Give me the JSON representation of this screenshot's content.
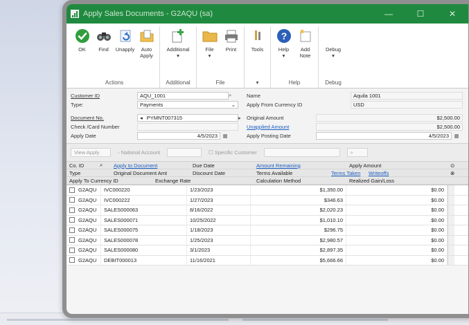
{
  "window": {
    "title": "Apply Sales Documents - G2AQU (sa)",
    "controls": [
      "—",
      "☐",
      "✕"
    ]
  },
  "ribbon": {
    "groups": [
      {
        "name": "Actions",
        "buttons": [
          {
            "label": "OK",
            "icon": "ok-check-icon"
          },
          {
            "label": "Find",
            "icon": "binoculars-icon"
          },
          {
            "label": "Unapply",
            "icon": "undo-icon"
          },
          {
            "label": "Auto Apply",
            "icon": "folder-auto-icon"
          }
        ]
      },
      {
        "name": "Additional",
        "buttons": [
          {
            "label": "Additional",
            "icon": "add-document-icon"
          }
        ]
      },
      {
        "name": "File",
        "buttons": [
          {
            "label": "File",
            "icon": "folder-icon"
          },
          {
            "label": "Print",
            "icon": "printer-icon"
          }
        ]
      },
      {
        "name": "",
        "buttons": [
          {
            "label": "Tools",
            "icon": "tools-icon"
          }
        ]
      },
      {
        "name": "Help",
        "buttons": [
          {
            "label": "Help",
            "icon": "help-icon"
          },
          {
            "label": "Add Note",
            "icon": "note-icon"
          }
        ]
      },
      {
        "name": "Debug",
        "buttons": [
          {
            "label": "Debug",
            "icon": "debug-icon"
          }
        ]
      }
    ]
  },
  "form": {
    "customer_id_label": "Customer ID",
    "customer_id": "AQU_1001",
    "name_label": "Name",
    "name": "Aquila 1001",
    "type_label": "Type:",
    "type": "Payments",
    "apply_currency_label": "Apply From Currency ID",
    "apply_currency": "USD",
    "document_no_label": "Document No.",
    "document_no": "PYMNT007315",
    "original_amount_label": "Original Amount",
    "original_amount": "$2,500.00",
    "check_card_label": "Check /Card Number",
    "unapplied_amount_label": "Unapplied Amount",
    "unapplied_amount": "$2,500.00",
    "apply_date_label": "Apply Date",
    "apply_date": "4/5/2023",
    "apply_posting_date_label": "Apply Posting Date",
    "apply_posting_date": "4/5/2023"
  },
  "filter": {
    "view_apply": "View Apply",
    "national_account": "National Account",
    "specific_customer": "Specific Customer"
  },
  "grid": {
    "header1": [
      "Co. ID",
      "Apply to Document",
      "Due Date",
      "Amount Remaining",
      "Apply Amount"
    ],
    "header2": [
      "Type",
      "Original Document Amt",
      "Discount Date",
      "Terms Available",
      "Terms Taken",
      "Writeoffs"
    ],
    "header3": [
      "Apply To Currency ID",
      "Exchange Rate",
      "Calculation Method",
      "Realized Gain/Loss"
    ],
    "rows": [
      {
        "co": "G2AQU",
        "doc": "IVC000220",
        "due": "1/23/2023",
        "remaining": "$1,350.00",
        "apply": "$0.00"
      },
      {
        "co": "G2AQU",
        "doc": "IVC000222",
        "due": "1/27/2023",
        "remaining": "$346.63",
        "apply": "$0.00"
      },
      {
        "co": "G2AQU",
        "doc": "SALES000063",
        "due": "8/16/2022",
        "remaining": "$2,020.23",
        "apply": "$0.00"
      },
      {
        "co": "G2AQU",
        "doc": "SALES000071",
        "due": "10/25/2022",
        "remaining": "$1,010.10",
        "apply": "$0.00"
      },
      {
        "co": "G2AQU",
        "doc": "SALES000075",
        "due": "1/18/2023",
        "remaining": "$296.75",
        "apply": "$0.00"
      },
      {
        "co": "G2AQU",
        "doc": "SALES000078",
        "due": "1/25/2023",
        "remaining": "$2,980.57",
        "apply": "$0.00"
      },
      {
        "co": "G2AQU",
        "doc": "SALES000080",
        "due": "3/1/2023",
        "remaining": "$2,897.35",
        "apply": "$0.00"
      },
      {
        "co": "G2AQU",
        "doc": "DEBIT000013",
        "due": "11/16/2021",
        "remaining": "$5,666.66",
        "apply": "$0.00"
      }
    ]
  },
  "colors": {
    "titlebar": "#1f8a3f",
    "link": "#1b5ec2"
  }
}
